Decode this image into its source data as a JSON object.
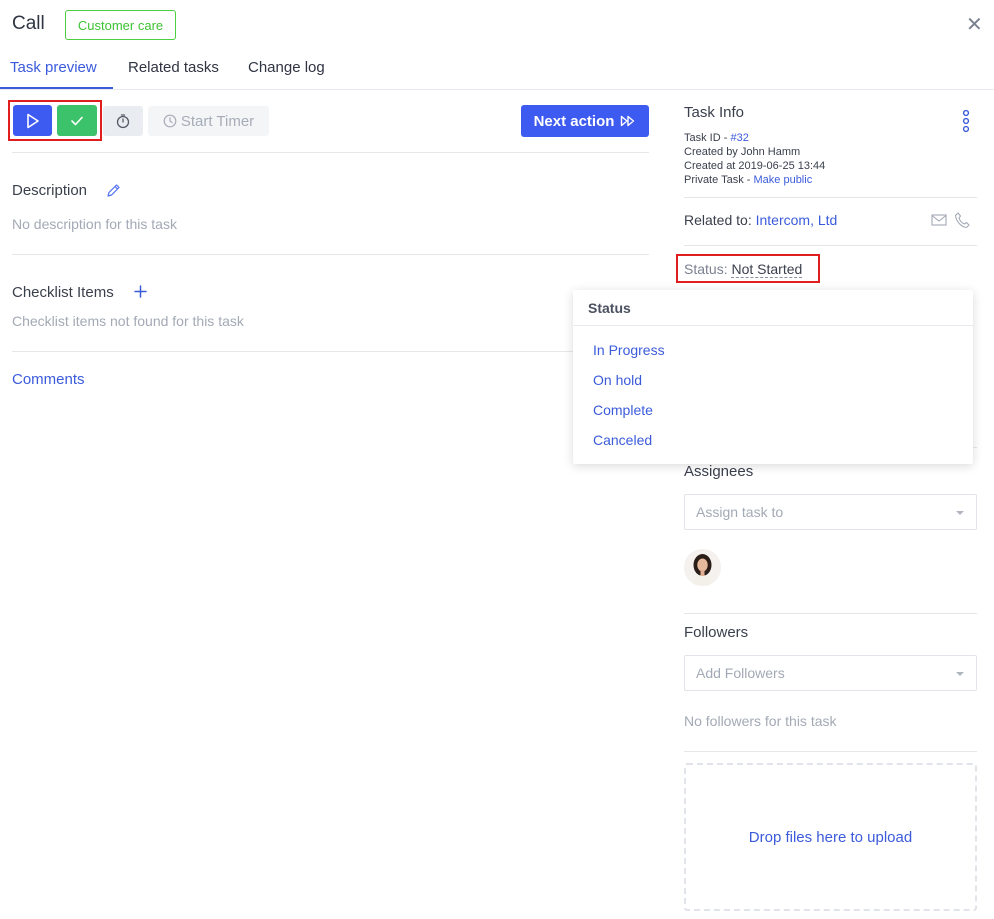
{
  "header": {
    "title": "Call",
    "badge": "Customer care",
    "close": "✕"
  },
  "tabs": [
    {
      "label": "Task preview",
      "active": true
    },
    {
      "label": "Related tasks",
      "active": false
    },
    {
      "label": "Change log",
      "active": false
    }
  ],
  "toolbar": {
    "start_timer_label": "Start Timer",
    "next_action_label": "Next action"
  },
  "description": {
    "title": "Description",
    "empty": "No description for this task"
  },
  "checklist": {
    "title": "Checklist Items",
    "empty": "Checklist items not found for this task"
  },
  "comments": {
    "label": "Comments"
  },
  "task_info": {
    "title": "Task Info",
    "task_id_label": "Task ID - ",
    "task_id": "#32",
    "created_by": "Created by John Hamm",
    "created_at": "Created at 2019-06-25 13:44",
    "private_label": "Private Task - ",
    "make_public": "Make public"
  },
  "related": {
    "label": "Related to: ",
    "value": "Intercom, Ltd"
  },
  "status": {
    "label": "Status: ",
    "value": "Not Started"
  },
  "status_menu": {
    "header": "Status",
    "options": [
      "In Progress",
      "On hold",
      "Complete",
      "Canceled"
    ]
  },
  "assignees": {
    "title": "Assignees",
    "placeholder": "Assign task to"
  },
  "followers": {
    "title": "Followers",
    "placeholder": "Add Followers",
    "empty": "No followers for this task"
  },
  "upload": {
    "label": "Drop files here to upload"
  },
  "colors": {
    "accent": "#3d5af1",
    "success": "#3cc26a",
    "highlight": "#e01e1e",
    "badge": "#4cce3f"
  }
}
